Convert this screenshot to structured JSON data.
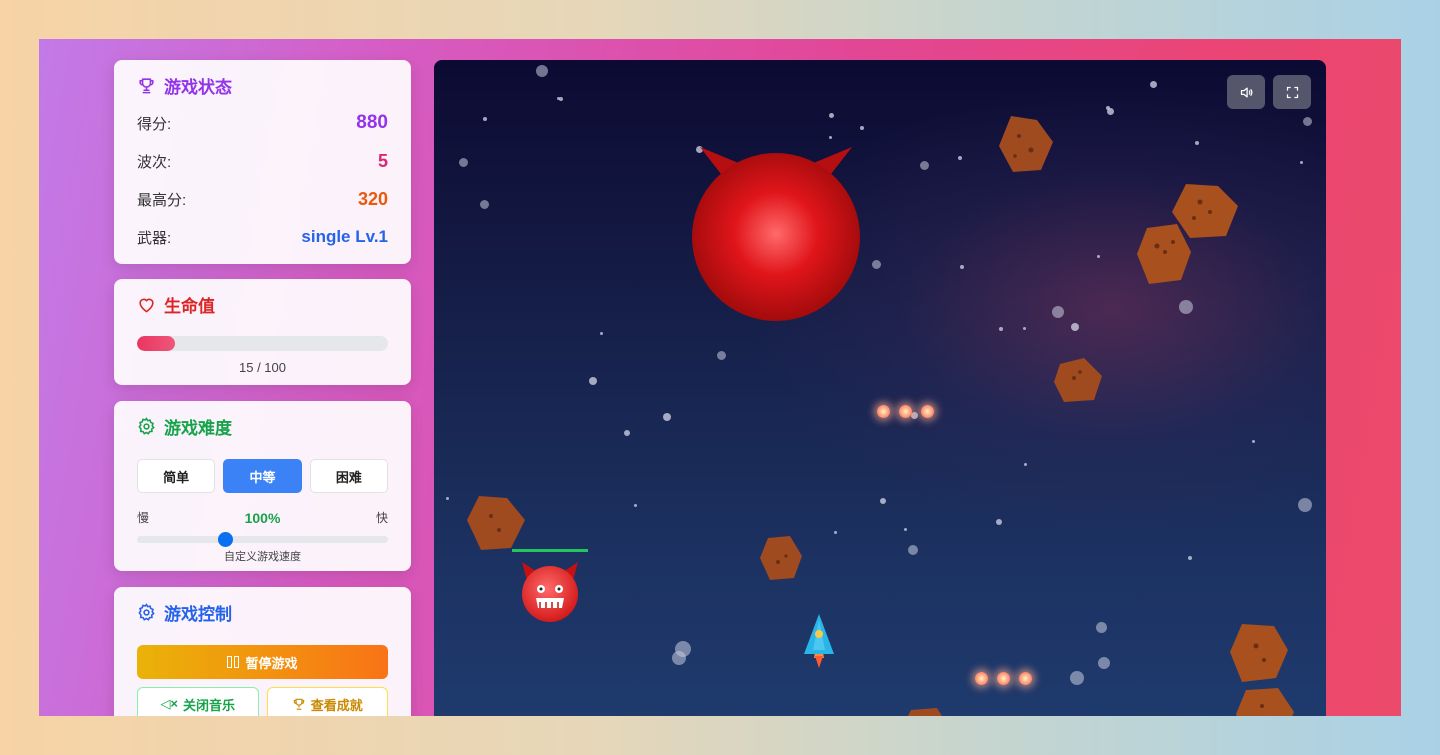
{
  "status": {
    "title": "游戏状态",
    "score_label": "得分:",
    "score": "880",
    "wave_label": "波次:",
    "wave": "5",
    "highscore_label": "最高分:",
    "highscore": "320",
    "weapon_label": "武器:",
    "weapon": "single Lv.1"
  },
  "health": {
    "title": "生命值",
    "current": 15,
    "max": 100,
    "text": "15 / 100"
  },
  "difficulty": {
    "title": "游戏难度",
    "options": [
      "简单",
      "中等",
      "困难"
    ],
    "selected": "中等",
    "slow_label": "慢",
    "fast_label": "快",
    "speed_value": "100%",
    "speed_fraction": 0.35,
    "slider_label": "自定义游戏速度"
  },
  "controls": {
    "title": "游戏控制",
    "pause_label": "暂停游戏",
    "music_label": "关闭音乐",
    "achievements_label": "查看成就"
  },
  "game": {
    "sound_icon": "volume-icon",
    "fullscreen_icon": "fullscreen-icon",
    "small_enemy_health_fraction": 1.0
  },
  "colors": {
    "status_title": "#9333ea",
    "score": "#9333ea",
    "wave": "#db2777",
    "highscore": "#ea580c",
    "weapon": "#2563eb",
    "health_title": "#dc2626",
    "difficulty_title": "#16a34a",
    "controls_title": "#2563eb",
    "music_button": "#16a34a",
    "achievements_button": "#ca8a04"
  }
}
